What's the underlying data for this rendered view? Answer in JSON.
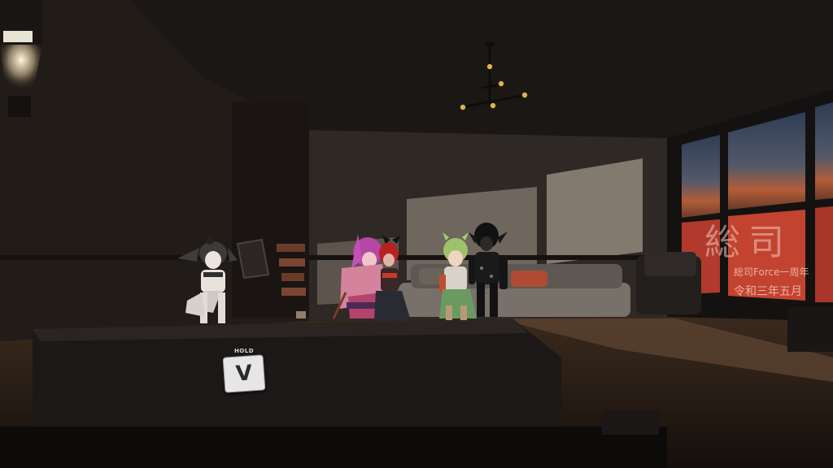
{
  "hud": {
    "prompt_label": "HOLD",
    "key": "V"
  },
  "window_sign": {
    "title": "総司",
    "line1": "総司Force一周年",
    "line2": "令和三年五月"
  },
  "colors": {
    "wall": "#2a2420",
    "floor": "#2b1f17",
    "sunlight": "#8f8478",
    "sky_top": "#3a4b64",
    "sky_horizon": "#c96a3d",
    "sign_red": "#c2362a"
  },
  "avatars": [
    {
      "name": "silver-hair-avatar",
      "hair": "#3b3b3b",
      "body": "#e8e2dc"
    },
    {
      "name": "pink-hair-avatar",
      "hair": "#c04aa8",
      "body": "#d9849a"
    },
    {
      "name": "red-hair-avatar",
      "hair": "#b4231f",
      "body": "#3d2b2b"
    },
    {
      "name": "green-hair-avatar",
      "hair": "#9dc26b",
      "body": "#7fae7a"
    },
    {
      "name": "black-suit-avatar",
      "hair": "#111111",
      "body": "#1a1a1a"
    }
  ]
}
